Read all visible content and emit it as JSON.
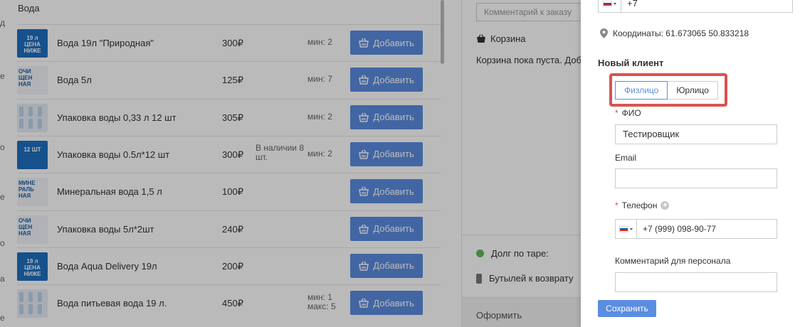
{
  "products": {
    "section_title": "Вода",
    "add_label": "Добавить",
    "items": [
      {
        "name": "Вода 19л \"Природная\"",
        "price": "300₽",
        "stock": "",
        "min": "мин: 2",
        "max": ""
      },
      {
        "name": "Вода 5л",
        "price": "125₽",
        "stock": "",
        "min": "мин: 7",
        "max": ""
      },
      {
        "name": "Упаковка воды 0,33 л 12 шт",
        "price": "305₽",
        "stock": "",
        "min": "мин: 2",
        "max": ""
      },
      {
        "name": "Упаковка воды 0.5л*12 шт",
        "price": "300₽",
        "stock": "В наличии 8 шт.",
        "min": "мин: 2",
        "max": ""
      },
      {
        "name": "Минеральная вода 1,5 л",
        "price": "100₽",
        "stock": "",
        "min": "",
        "max": ""
      },
      {
        "name": "Упаковка воды 5л*2шт",
        "price": "240₽",
        "stock": "",
        "min": "",
        "max": ""
      },
      {
        "name": "Вода Aqua Delivery 19л",
        "price": "200₽",
        "stock": "",
        "min": "",
        "max": ""
      },
      {
        "name": "Вода питьевая вода 19 л.",
        "price": "450₽",
        "stock": "",
        "min": "мин: 1",
        "max": "макс: 5"
      }
    ],
    "thumbs": [
      {
        "text": "19 л\nЦЕНА\nНИЖЕ"
      },
      {
        "text": "ОЧИ\nЩЕН\nНАЯ"
      },
      {
        "text": ""
      },
      {
        "text": "12 ШТ"
      },
      {
        "text": "МИНЕ\nРАЛЬ\nНАЯ"
      },
      {
        "text": "ОЧИ\nЩЕН\nНАЯ"
      },
      {
        "text": "19 л\nЦЕНА\nНИЖЕ"
      },
      {
        "text": ""
      }
    ]
  },
  "order": {
    "comment_placeholder": "Комментарий к заказу",
    "cart_title": "Корзина",
    "cart_empty": "Корзина пока пуста. Добавьте товары",
    "debt_label": "Долг по таре:",
    "bottles_label": "Бутылей к возврату",
    "checkout_label": "Оформить"
  },
  "panel": {
    "top_phone": "+7",
    "coords": "Координаты: 61.673065 50.833218",
    "new_client_title": "Новый клиент",
    "tabs": [
      "Физлицо",
      "Юрлицо"
    ],
    "active_tab": "Физлицо",
    "fio_label": "ФИО",
    "fio_value": "Тестировщик",
    "email_label": "Email",
    "email_value": "",
    "phone_label": "Телефон",
    "phone_value": "+7 (999) 098-90-77",
    "staff_comment_label": "Комментарий для персонала",
    "staff_comment_value": "",
    "save_label": "Сохранить",
    "accent_color": "#5b8de0",
    "highlight_color": "#d9534f"
  }
}
